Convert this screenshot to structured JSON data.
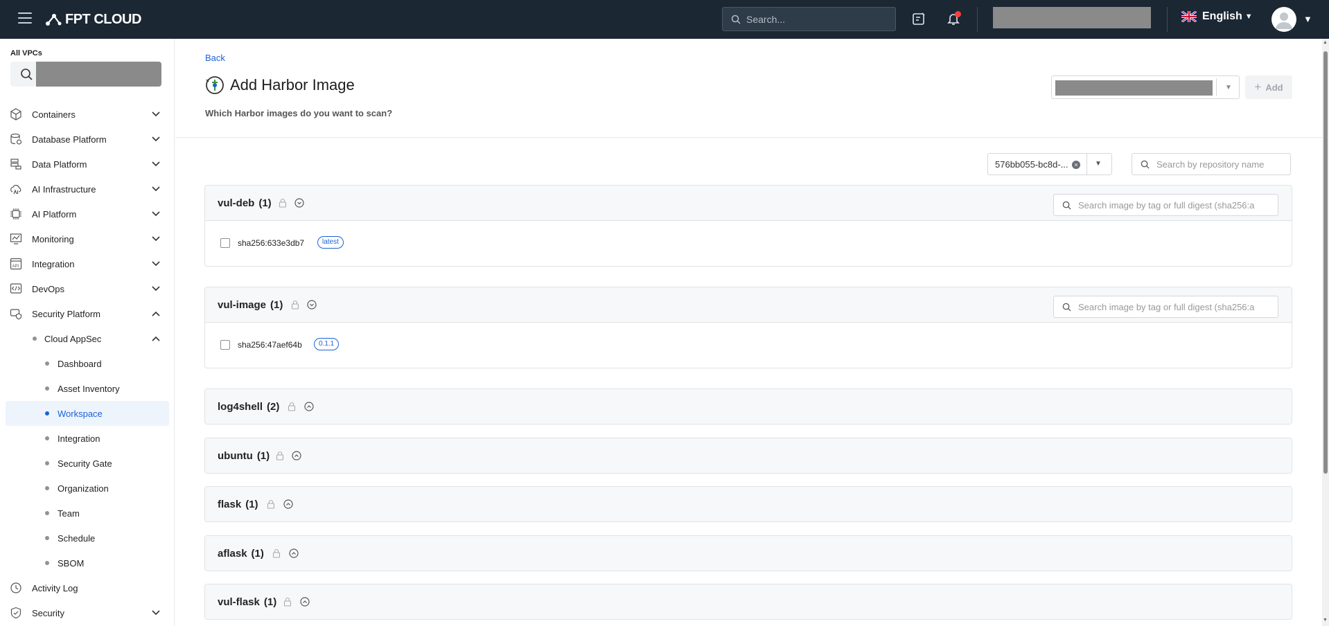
{
  "header": {
    "brand": "FPT CLOUD",
    "search_placeholder": "Search...",
    "language": "English"
  },
  "sidebar": {
    "vpc_label": "All VPCs",
    "items": [
      {
        "label": "Containers",
        "icon": "cube-icon"
      },
      {
        "label": "Database Platform",
        "icon": "database-icon"
      },
      {
        "label": "Data Platform",
        "icon": "data-stack-icon"
      },
      {
        "label": "AI Infrastructure",
        "icon": "ai-cloud-icon"
      },
      {
        "label": "AI Platform",
        "icon": "ai-chip-icon"
      },
      {
        "label": "Monitoring",
        "icon": "monitor-icon"
      },
      {
        "label": "Integration",
        "icon": "api-icon"
      },
      {
        "label": "DevOps",
        "icon": "code-icon"
      },
      {
        "label": "Security Platform",
        "icon": "security-platform-icon"
      }
    ],
    "cloud_appsec": "Cloud AppSec",
    "sub_items": [
      "Dashboard",
      "Asset Inventory",
      "Workspace",
      "Integration",
      "Security Gate",
      "Organization",
      "Team",
      "Schedule",
      "SBOM"
    ],
    "active_sub_item": "Workspace",
    "bottom_items": [
      {
        "label": "Activity Log",
        "icon": "clock-icon"
      },
      {
        "label": "Security",
        "icon": "shield-icon"
      }
    ]
  },
  "main": {
    "back_label": "Back",
    "title": "Add Harbor Image",
    "subtitle": "Which Harbor images do you want to scan?",
    "add_label": "Add",
    "project_value": "576bb055-bc8d-...",
    "repo_search_placeholder": "Search by repository name",
    "tag_search_placeholder": "Search image by tag or full digest (sha256:a",
    "repositories": [
      {
        "name": "vul-deb",
        "count": "(1)",
        "expanded": true,
        "images": [
          {
            "digest": "sha256:633e3db7",
            "tag": "latest"
          }
        ]
      },
      {
        "name": "vul-image",
        "count": "(1)",
        "expanded": true,
        "images": [
          {
            "digest": "sha256:47aef64b",
            "tag": "0.1.1"
          }
        ]
      },
      {
        "name": "log4shell",
        "count": "(2)",
        "expanded": false
      },
      {
        "name": "ubuntu",
        "count": "(1)",
        "expanded": false
      },
      {
        "name": "flask",
        "count": "(1)",
        "expanded": false
      },
      {
        "name": "aflask",
        "count": "(1)",
        "expanded": false
      },
      {
        "name": "vul-flask",
        "count": "(1)",
        "expanded": false
      }
    ]
  },
  "colors": {
    "header_bg": "#1b2733",
    "accent": "#1a62d6",
    "active_bg": "#eef4fc",
    "notification": "#ff3b3b"
  }
}
